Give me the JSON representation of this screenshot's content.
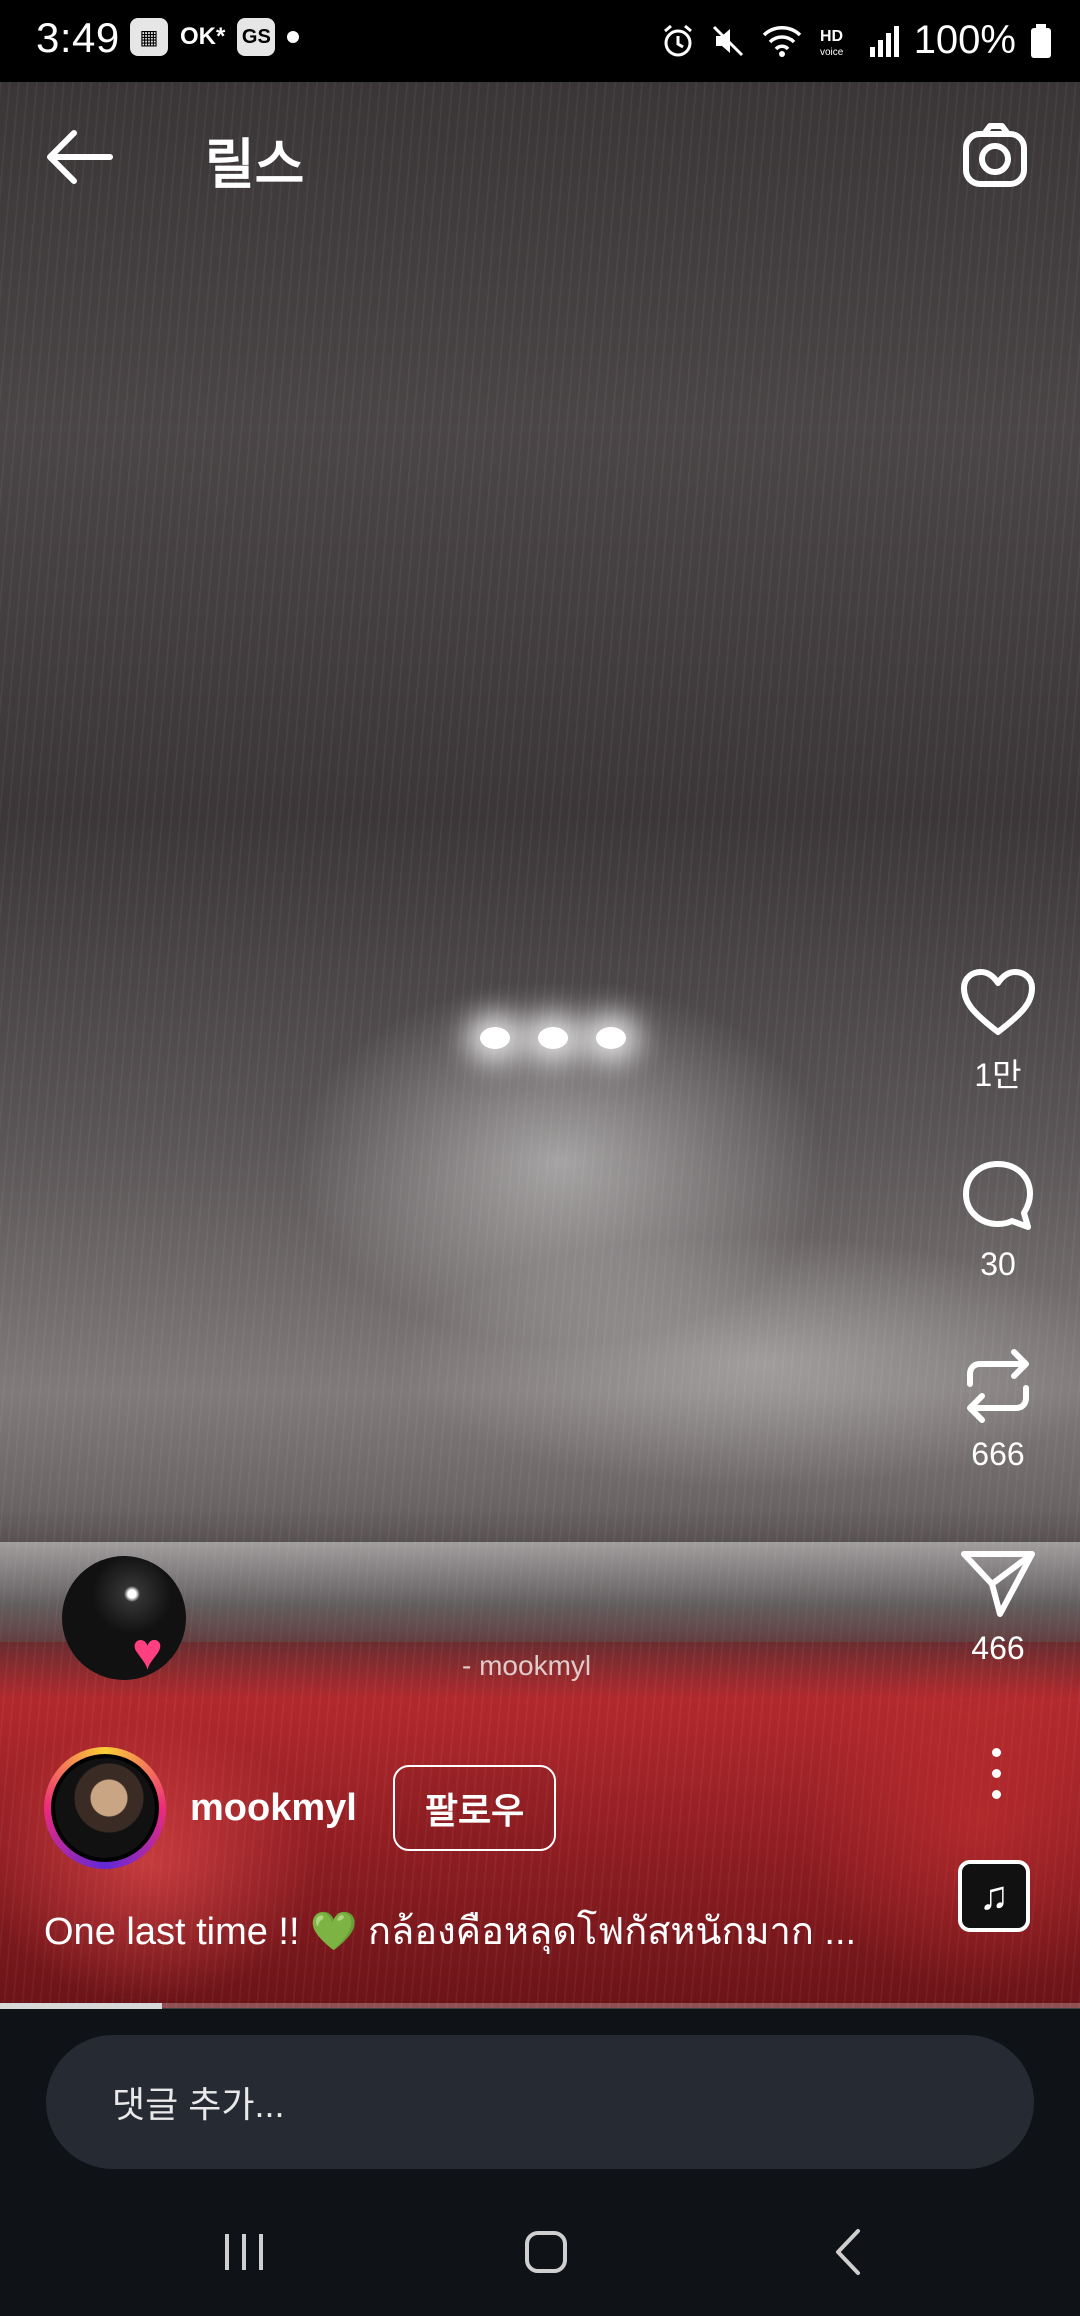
{
  "status_bar": {
    "time": "3:49",
    "left_icons": [
      "gallery-icon",
      "ok-icon",
      "gs-icon",
      "dot-icon"
    ],
    "ok_text": "OK*",
    "gs_text": "GS",
    "right_icons": [
      "alarm-icon",
      "mute-icon",
      "wifi-icon",
      "hd-voice-icon",
      "signal-icon",
      "battery-icon"
    ],
    "battery": "100%"
  },
  "header": {
    "title": "릴스",
    "back_icon": "back-arrow-icon",
    "camera_icon": "camera-icon"
  },
  "video": {
    "watermark": "- mookmyl",
    "progress": 0.15
  },
  "actions": {
    "like_count": "1만",
    "comment_count": "30",
    "repost_count": "666",
    "share_count": "466"
  },
  "author": {
    "username": "mookmyl",
    "follow_label": "팔로우"
  },
  "caption": {
    "text_before": "One last time !! ",
    "emoji": "💚",
    "text_after": " กล้องคือหลุดโฟกัสหนักมาก ..."
  },
  "comment": {
    "placeholder": "댓글 추가..."
  },
  "nav": {
    "recents_icon": "recents-icon",
    "home_icon": "home-icon",
    "back_icon": "nav-back-icon"
  }
}
